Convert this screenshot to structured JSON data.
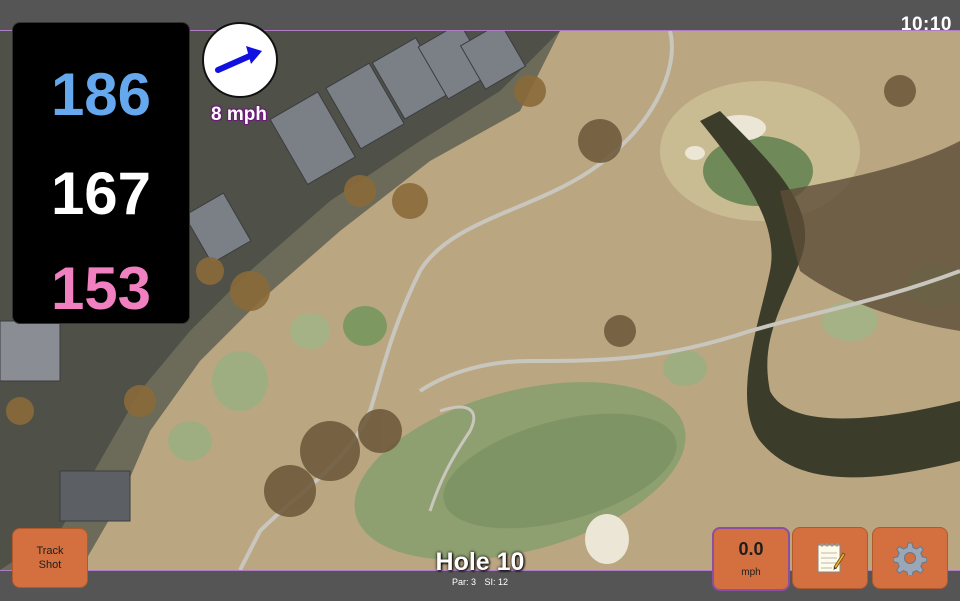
{
  "status": {
    "time": "10:10"
  },
  "distances": {
    "back": "186",
    "middle": "167",
    "front": "153"
  },
  "distance_colors": {
    "back": "#66a8ee",
    "middle": "#ffffff",
    "front": "#f080c0"
  },
  "wind": {
    "speed_label": "8 mph",
    "direction_icon": "arrow-right-icon"
  },
  "buttons": {
    "track_shot": {
      "line1": "Track",
      "line2": "Shot"
    },
    "speed": {
      "value": "0.0",
      "unit": "mph"
    },
    "notes_icon": "notepad-icon",
    "settings_icon": "gear-icon"
  },
  "hole": {
    "title": "Hole 10",
    "par": "Par: 3",
    "si": "SI: 12"
  },
  "colors": {
    "button": "#d4703f",
    "accent_border": "#b07cc6",
    "bar": "#555555"
  }
}
